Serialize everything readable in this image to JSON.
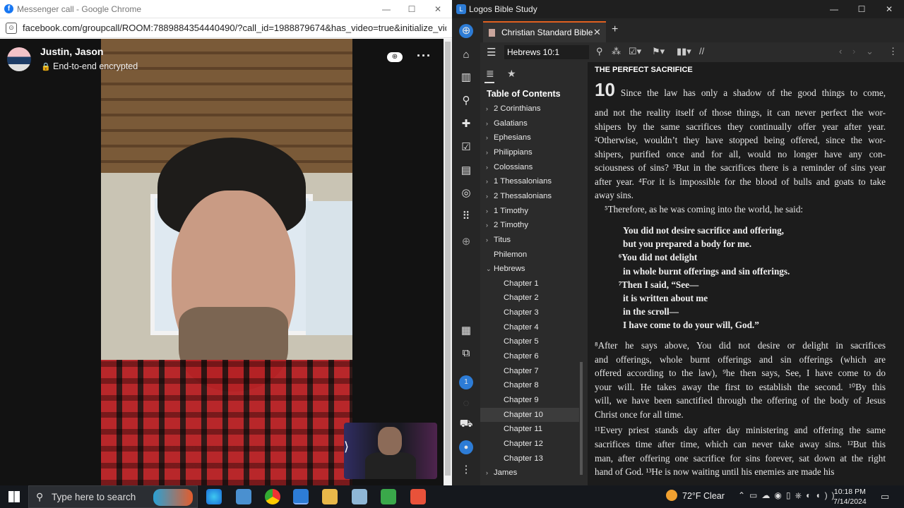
{
  "chrome": {
    "title": "Messenger call - Google Chrome",
    "url": "facebook.com/groupcall/ROOM:7889884354440490/?call_id=1988879674&has_video=true&initialize_video=true...",
    "call": {
      "caller": "Justin, Jason",
      "status": "End-to-end encrypted"
    }
  },
  "logos": {
    "title": "Logos Bible Study",
    "tab_label": "Christian Standard Bible",
    "reference": "Hebrews 10:1",
    "toc_title": "Table of Contents",
    "toc": [
      {
        "label": "2 Corinthians",
        "chevron": "›",
        "sub": false
      },
      {
        "label": "Galatians",
        "chevron": "›",
        "sub": false
      },
      {
        "label": "Ephesians",
        "chevron": "›",
        "sub": false
      },
      {
        "label": "Philippians",
        "chevron": "›",
        "sub": false
      },
      {
        "label": "Colossians",
        "chevron": "›",
        "sub": false
      },
      {
        "label": "1 Thessalonians",
        "chevron": "›",
        "sub": false
      },
      {
        "label": "2 Thessalonians",
        "chevron": "›",
        "sub": false
      },
      {
        "label": "1 Timothy",
        "chevron": "›",
        "sub": false
      },
      {
        "label": "2 Timothy",
        "chevron": "›",
        "sub": false
      },
      {
        "label": "Titus",
        "chevron": "›",
        "sub": false
      },
      {
        "label": "Philemon",
        "chevron": "",
        "sub": false
      },
      {
        "label": "Hebrews",
        "chevron": "⌄",
        "sub": false
      },
      {
        "label": "Chapter 1",
        "chevron": "",
        "sub": true
      },
      {
        "label": "Chapter 2",
        "chevron": "",
        "sub": true
      },
      {
        "label": "Chapter 3",
        "chevron": "",
        "sub": true
      },
      {
        "label": "Chapter 4",
        "chevron": "",
        "sub": true
      },
      {
        "label": "Chapter 5",
        "chevron": "",
        "sub": true
      },
      {
        "label": "Chapter 6",
        "chevron": "",
        "sub": true
      },
      {
        "label": "Chapter 7",
        "chevron": "",
        "sub": true
      },
      {
        "label": "Chapter 8",
        "chevron": "",
        "sub": true
      },
      {
        "label": "Chapter 9",
        "chevron": "",
        "sub": true
      },
      {
        "label": "Chapter 10",
        "chevron": "",
        "sub": true,
        "selected": true
      },
      {
        "label": "Chapter 11",
        "chevron": "",
        "sub": true
      },
      {
        "label": "Chapter 12",
        "chevron": "",
        "sub": true
      },
      {
        "label": "Chapter 13",
        "chevron": "",
        "sub": true
      },
      {
        "label": "James",
        "chevron": "›",
        "sub": false
      }
    ],
    "heading": "THE PERFECT SACRIFICE",
    "chapter_number": "10",
    "lines": [
      "Since the law has only a shadow of the good things to come,",
      "and not the reality itself of those things, it can never perfect the wor-",
      "shipers by the same sacrifices they continually offer year after year.",
      "²Otherwise, wouldn’t they have stopped being offered, since the wor-",
      "shipers, purified once and for all, would no longer have any con-",
      "sciousness of sins? ³But in the sacrifices there is a reminder of sins year",
      "after year. ⁴For it is impossible for the blood of bulls and goats to take",
      "away sins."
    ],
    "verse5": "⁵Therefore, as he was coming into the world, he said:",
    "poem": [
      "You did not desire sacrifice and offering,",
      "but you prepared a body for me.",
      "⁶You did not delight",
      "in whole burnt offerings and sin offerings.",
      "⁷Then I said, “See—",
      "it is written about me",
      "in the scroll—",
      "I have come to do your will, God.”"
    ],
    "lines2": [
      "⁸After he says above, You did not desire or delight in sacrifices",
      "and offerings, whole burnt offerings and sin offerings (which are",
      "offered according to the law), ⁹he then says, See, I have come to do",
      "your will. He takes away the first to establish the second. ¹⁰By this",
      "will, we have been sanctified through the offering of the body of Jesus",
      "Christ once for all time."
    ],
    "lines3": [
      "¹¹Every priest stands day after day ministering and offering the same",
      "sacrifices time after time, which can never take away sins. ¹²But this",
      "man, after offering one sacrifice for sins forever, sat down at the right",
      "hand of God. ¹³He is now waiting until his enemies are made his"
    ]
  },
  "taskbar": {
    "search_placeholder": "Type here to search",
    "weather": "72°F  Clear",
    "time": "10:18 PM",
    "date": "7/14/2024"
  }
}
